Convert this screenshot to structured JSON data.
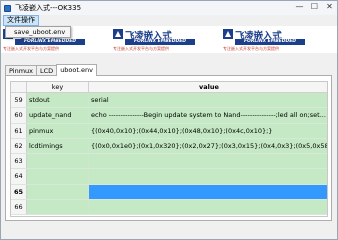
{
  "window": {
    "title": "飞凌嵌入式---OK335",
    "minimize": "—",
    "maximize": "☐",
    "close": "✕"
  },
  "menu": {
    "file": "文件操作",
    "dropdown_items": [
      "save_uboot.env"
    ]
  },
  "banner": {
    "brand_cn": "飞凌嵌入式",
    "brand_en": "FORLINX EMBEDDED",
    "slogan": "专注嵌入式开发平台与方案提供",
    "accent": "#1c3f8c"
  },
  "tabs": [
    {
      "label": "Pinmux",
      "active": false
    },
    {
      "label": "LCD",
      "active": false
    },
    {
      "label": "uboot.env",
      "active": true
    }
  ],
  "grid": {
    "col_key": "key",
    "col_value": "value",
    "rows": [
      {
        "num": "59",
        "key": "stdout",
        "value": "serial"
      },
      {
        "num": "60",
        "key": "update_nand",
        "value": "echo ---------------Begin update system to Nand---------------;led all on;set..."
      },
      {
        "num": "61",
        "key": "pinmux",
        "value": "{(0x40,0x10};(0x44,0x10};(0x48,0x10};(0x4c,0x10};}"
      },
      {
        "num": "62",
        "key": "lcdtimings",
        "value": "{(0x0,0x1e0};(0x1,0x320};(0x2,0x27};(0x3,0x15};(0x4,0x3};(0x5,0x58};(0x6,0x..."
      },
      {
        "num": "63",
        "key": "",
        "value": ""
      },
      {
        "num": "64",
        "key": "",
        "value": ""
      },
      {
        "num": "65",
        "key": "",
        "value": ""
      },
      {
        "num": "66",
        "key": "",
        "value": ""
      }
    ]
  }
}
